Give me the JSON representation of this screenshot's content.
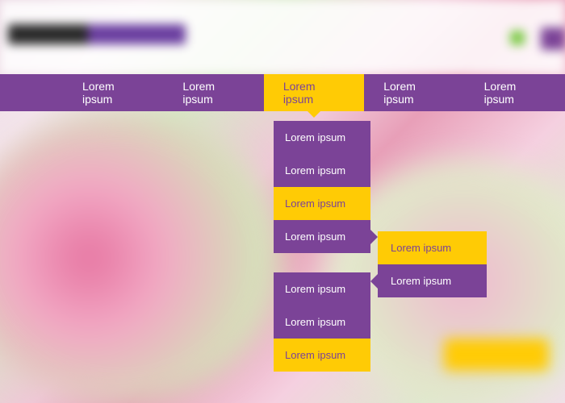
{
  "colors": {
    "purple": "#7b4397",
    "yellow": "#ffcb05"
  },
  "nav": {
    "items": [
      {
        "label": "Lorem ipsum"
      },
      {
        "label": "Lorem ipsum"
      },
      {
        "label": "Lorem ipsum"
      },
      {
        "label": "Lorem ipsum"
      },
      {
        "label": "Lorem ipsum"
      }
    ]
  },
  "dropdown1": [
    {
      "label": "Lorem ipsum"
    },
    {
      "label": "Lorem ipsum"
    },
    {
      "label": "Lorem ipsum"
    },
    {
      "label": "Lorem ipsum"
    }
  ],
  "dropdown2": [
    {
      "label": "Lorem ipsum"
    },
    {
      "label": "Lorem ipsum"
    },
    {
      "label": "Lorem ipsum"
    }
  ],
  "flyout": [
    {
      "label": "Lorem ipsum"
    },
    {
      "label": "Lorem ipsum"
    }
  ]
}
